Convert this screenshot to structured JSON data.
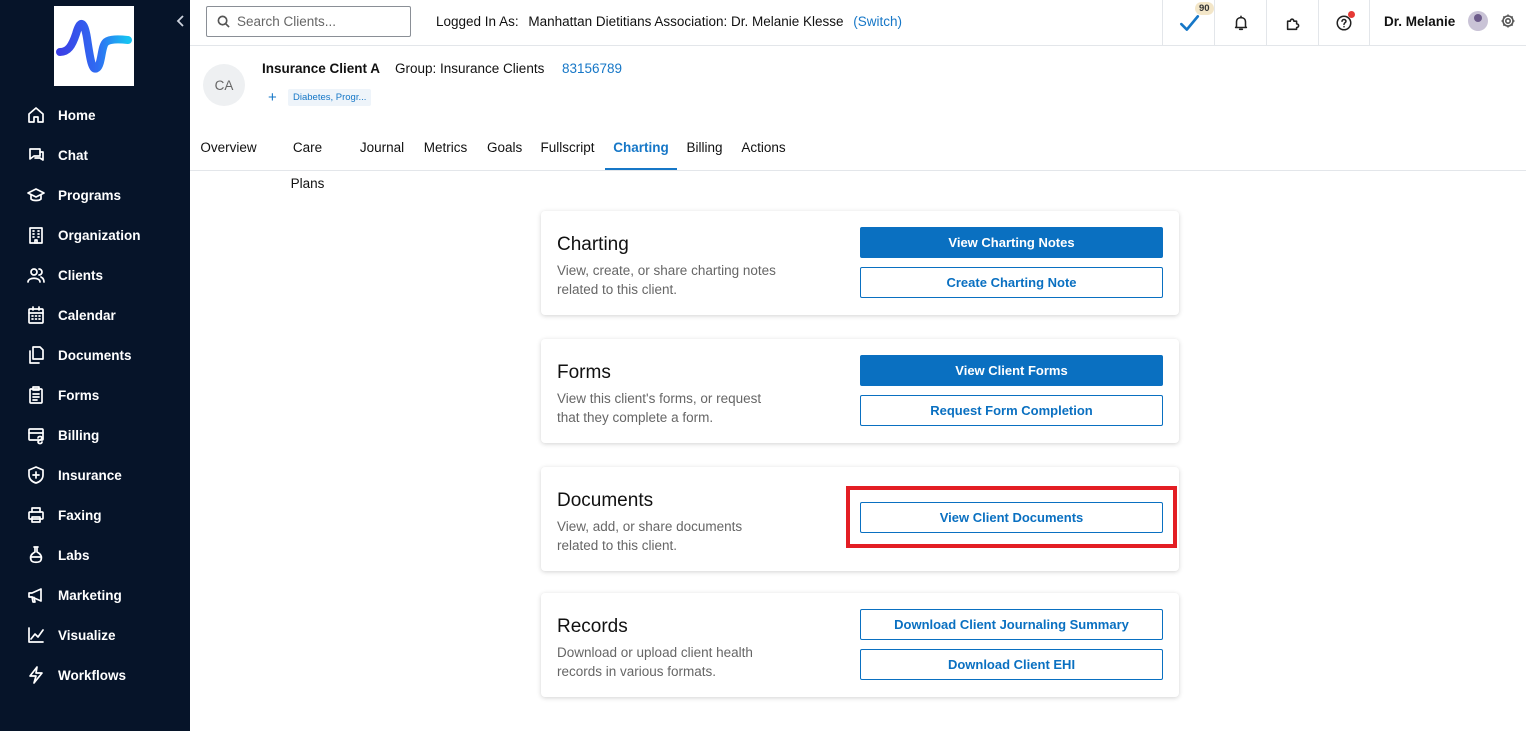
{
  "sidebar": {
    "collapse_icon": "chevron-left-icon",
    "items": [
      {
        "label": "Home",
        "icon": "home-icon"
      },
      {
        "label": "Chat",
        "icon": "chat-icon"
      },
      {
        "label": "Programs",
        "icon": "graduation-cap-icon"
      },
      {
        "label": "Organization",
        "icon": "building-icon"
      },
      {
        "label": "Clients",
        "icon": "users-icon"
      },
      {
        "label": "Calendar",
        "icon": "calendar-icon"
      },
      {
        "label": "Documents",
        "icon": "documents-icon"
      },
      {
        "label": "Forms",
        "icon": "clipboard-icon"
      },
      {
        "label": "Billing",
        "icon": "billing-icon"
      },
      {
        "label": "Insurance",
        "icon": "shield-icon"
      },
      {
        "label": "Faxing",
        "icon": "printer-icon"
      },
      {
        "label": "Labs",
        "icon": "flask-icon"
      },
      {
        "label": "Marketing",
        "icon": "megaphone-icon"
      },
      {
        "label": "Visualize",
        "icon": "chart-icon"
      },
      {
        "label": "Workflows",
        "icon": "lightning-icon"
      }
    ]
  },
  "topbar": {
    "search_placeholder": "Search Clients...",
    "logged_in_label": "Logged In As:",
    "logged_in_org": "Manhattan Dietitians Association: Dr. Melanie Klesse",
    "switch_label": "(Switch)",
    "tasks_badge": "90",
    "user_name": "Dr. Melanie"
  },
  "client": {
    "initials": "CA",
    "name": "Insurance Client A",
    "group": "Group: Insurance Clients",
    "id": "83156789",
    "tag_plus": "+",
    "tag": "Diabetes, Progr..."
  },
  "tabs": [
    "Overview",
    "Care Plans",
    "Journal",
    "Metrics",
    "Goals",
    "Fullscript",
    "Charting",
    "Billing",
    "Actions"
  ],
  "active_tab": "Charting",
  "cards": {
    "charting": {
      "title": "Charting",
      "description": "View, create, or share charting notes related to this client.",
      "btn1": "View Charting Notes",
      "btn2": "Create Charting Note"
    },
    "forms": {
      "title": "Forms",
      "description": "View this client's forms, or request that they complete a form.",
      "btn1": "View Client Forms",
      "btn2": "Request Form Completion"
    },
    "documents": {
      "title": "Documents",
      "description": "View, add, or share documents related to this client.",
      "btn1": "View Client Documents"
    },
    "records": {
      "title": "Records",
      "description": "Download or upload client health records in various formats.",
      "btn1": "Download Client Journaling Summary",
      "btn2": "Download Client EHI"
    }
  },
  "colors": {
    "sidebar_bg": "#061429",
    "primary": "#0a70c1",
    "highlight": "#e31e24"
  }
}
